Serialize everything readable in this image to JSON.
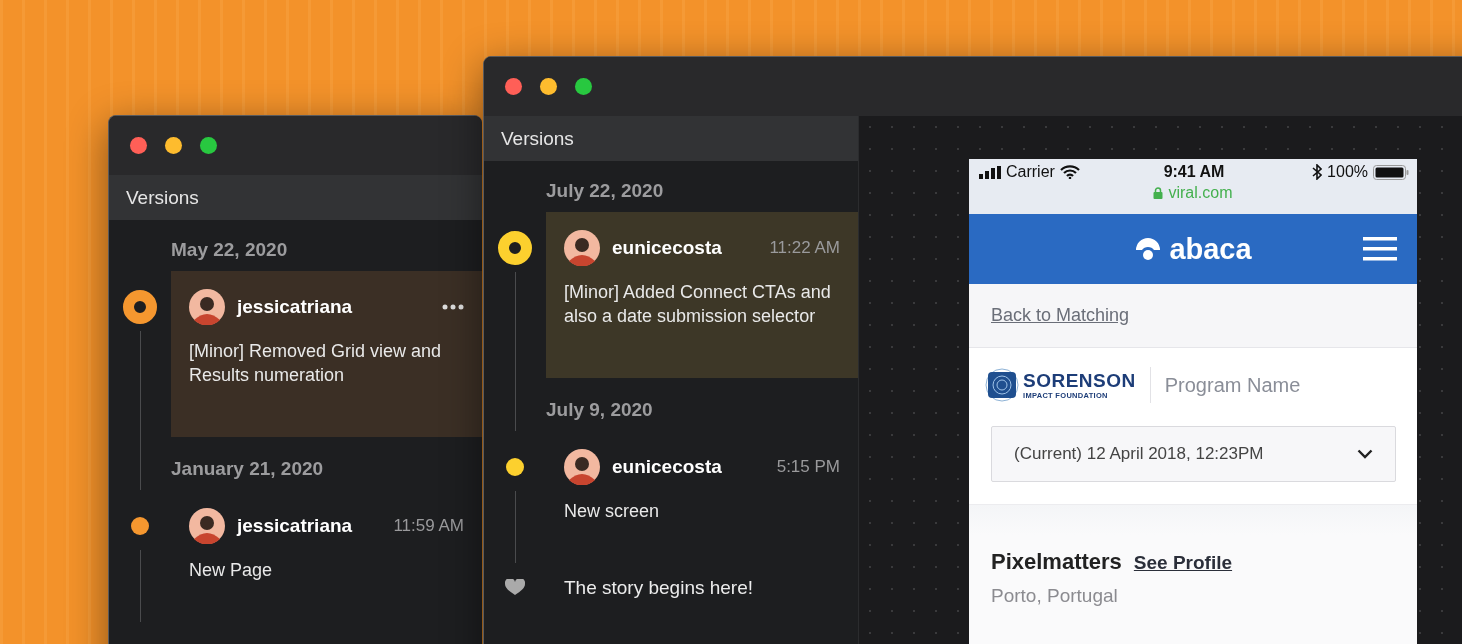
{
  "back_window": {
    "panel_title": "Versions",
    "groups": [
      {
        "date": "May 22, 2020",
        "entries": [
          {
            "author": "jessicatriana",
            "menu_shown": true,
            "message": "[Minor] Removed Grid view and Results numeration",
            "selected": true
          }
        ]
      },
      {
        "date": "January 21, 2020",
        "entries": [
          {
            "author": "jessicatriana",
            "time": "11:59 AM",
            "menu_shown": false,
            "message": "New Page",
            "selected": false
          }
        ]
      }
    ]
  },
  "front_window": {
    "panel_title": "Versions",
    "groups": [
      {
        "date": "July 22, 2020",
        "entries": [
          {
            "author": "eunicecosta",
            "time": "11:22 AM",
            "menu_shown": false,
            "message": "[Minor] Added Connect CTAs and also a date submission selector",
            "selected": true
          }
        ]
      },
      {
        "date": "July 9, 2020",
        "entries": [
          {
            "author": "eunicecosta",
            "time": "5:15 PM",
            "menu_shown": false,
            "message": "New screen",
            "selected": false
          }
        ]
      }
    ],
    "origin": {
      "text": "The story begins here!"
    },
    "preview": {
      "status_bar": {
        "carrier": "Carrier",
        "time": "9:41 AM",
        "battery": "100%"
      },
      "address": "viral.com",
      "brand": "abaca",
      "back_link": "Back to Matching",
      "organization": {
        "name": "SORENSON",
        "subtitle": "IMPACT FOUNDATION"
      },
      "program": "Program Name",
      "version_select": {
        "value": "(Current) 12 April 2018, 12:23PM"
      },
      "company": {
        "name": "Pixelmatters",
        "profile_link": "See Profile",
        "location": "Porto, Portugal"
      }
    }
  }
}
